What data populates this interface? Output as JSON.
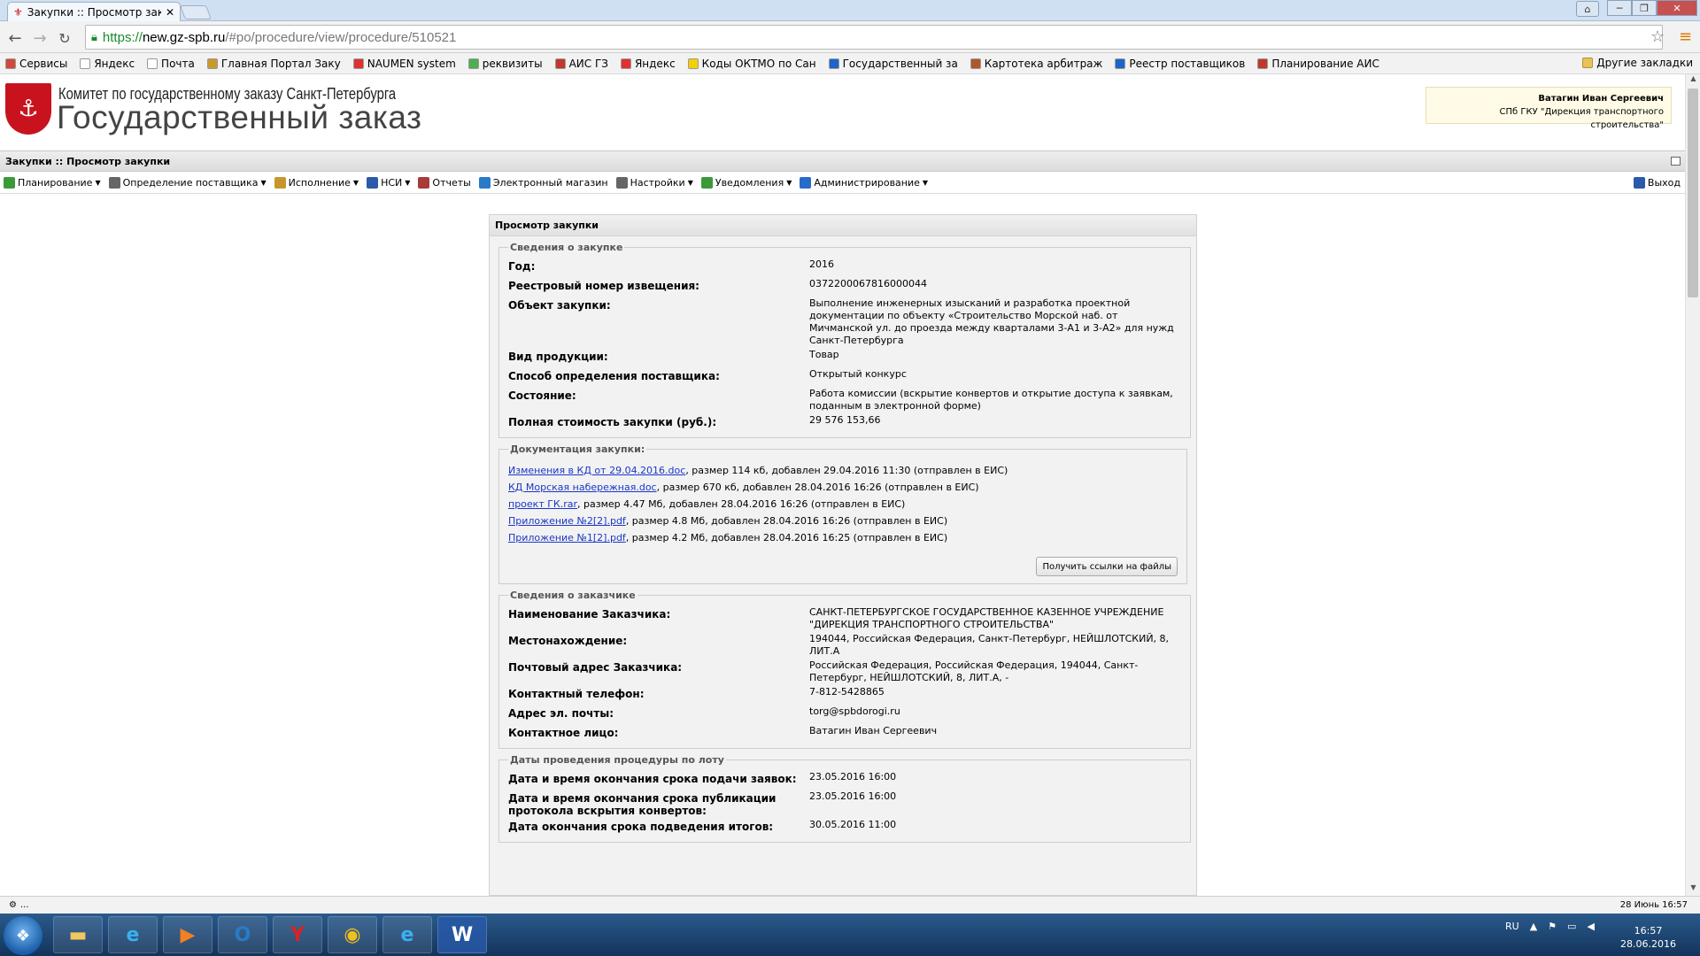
{
  "browser": {
    "tab_title": "Закупки :: Просмотр закупки",
    "url_scheme": "https://",
    "url_host": "new.gz-spb.ru",
    "url_path": "/#po/procedure/view/procedure/510521"
  },
  "bookmarks": [
    {
      "label": "Сервисы",
      "color": "#d04a3b"
    },
    {
      "label": "Яндекс",
      "color": "#ffffff"
    },
    {
      "label": "Почта",
      "color": "#ffffff"
    },
    {
      "label": "Главная Портал Заку",
      "color": "#c89a2a"
    },
    {
      "label": "NAUMEN system",
      "color": "#e03030"
    },
    {
      "label": "реквизиты",
      "color": "#4caf50"
    },
    {
      "label": "АИС ГЗ",
      "color": "#c0392b"
    },
    {
      "label": "Яндекс",
      "color": "#e03030"
    },
    {
      "label": "Коды ОКТМО по Сан",
      "color": "#f5d000"
    },
    {
      "label": "Государственный за",
      "color": "#1e64c8"
    },
    {
      "label": "Картотека арбитраж",
      "color": "#b0562a"
    },
    {
      "label": "Реестр поставщиков",
      "color": "#1e64c8"
    },
    {
      "label": "Планирование АИС",
      "color": "#c0392b"
    }
  ],
  "bookmarks_other": "Другие закладки",
  "header": {
    "org_name": "Комитет по государственному заказу Санкт-Петербурга",
    "site_title": "Государственный заказ",
    "user_name": "Ватагин Иван Сергеевич",
    "user_org": "СПб ГКУ \"Дирекция транспортного строительства\""
  },
  "panel_title": "Закупки :: Просмотр закупки",
  "menu": [
    {
      "label": "Планирование",
      "dropdown": true,
      "color": "#3a9a3a"
    },
    {
      "label": "Определение поставщика",
      "dropdown": true,
      "color": "#666666"
    },
    {
      "label": "Исполнение",
      "dropdown": true,
      "color": "#c8962a"
    },
    {
      "label": "НСИ",
      "dropdown": true,
      "color": "#2a5aa8"
    },
    {
      "label": "Отчеты",
      "dropdown": false,
      "color": "#a83a3a"
    },
    {
      "label": "Электронный магазин",
      "dropdown": false,
      "color": "#2a7ac8"
    },
    {
      "label": "Настройки",
      "dropdown": true,
      "color": "#666666"
    },
    {
      "label": "Уведомления",
      "dropdown": true,
      "color": "#3a9a3a"
    },
    {
      "label": "Администрирование",
      "dropdown": true,
      "color": "#2a6ac8"
    }
  ],
  "logout_label": "Выход",
  "view": {
    "title": "Просмотр закупки",
    "purchase_legend": "Сведения о закупке",
    "purchase": [
      {
        "label": "Год:",
        "value": "2016"
      },
      {
        "label": "Реестровый номер извещения:",
        "value": "0372200067816000044"
      },
      {
        "label": "Объект закупки:",
        "value": "Выполнение инженерных изысканий и разработка проектной документации по объекту «Строительство Морской наб. от Мичманской ул. до проезда между кварталами 3-А1 и 3-А2» для нужд Санкт-Петербурга"
      },
      {
        "label": "Вид продукции:",
        "value": "Товар"
      },
      {
        "label": "Способ определения поставщика:",
        "value": "Открытый конкурс"
      },
      {
        "label": "Состояние:",
        "value": "Работа комиссии (вскрытие конвертов и открытие доступа к заявкам, поданным в электронной форме)"
      },
      {
        "label": "Полная стоимость закупки (руб.):",
        "value": "29 576 153,66"
      }
    ],
    "docs_legend": "Документация закупки:",
    "docs": [
      {
        "name": "Изменения в КД   от 29.04.2016.doc",
        "info": ", размер 114 кб, добавлен 29.04.2016 11:30 (отправлен в ЕИС)"
      },
      {
        "name": "КД Морская набережная.doc",
        "info": ", размер 670 кб, добавлен 28.04.2016 16:26 (отправлен в ЕИС)"
      },
      {
        "name": "проект ГК.rar",
        "info": ", размер 4.47 Мб, добавлен 28.04.2016 16:26 (отправлен в ЕИС)"
      },
      {
        "name": "Приложение №2[2].pdf",
        "info": ", размер 4.8 Мб, добавлен 28.04.2016 16:26 (отправлен в ЕИС)"
      },
      {
        "name": "Приложение №1[2].pdf",
        "info": ", размер 4.2 Мб, добавлен 28.04.2016 16:25 (отправлен в ЕИС)"
      }
    ],
    "get_links_label": "Получить ссылки на файлы",
    "customer_legend": "Сведения о заказчике",
    "customer": [
      {
        "label": "Наименование Заказчика:",
        "value": "САНКТ-ПЕТЕРБУРГСКОЕ ГОСУДАРСТВЕННОЕ КАЗЕННОЕ УЧРЕЖДЕНИЕ \"ДИРЕКЦИЯ ТРАНСПОРТНОГО СТРОИТЕЛЬСТВА\""
      },
      {
        "label": "Местонахождение:",
        "value": "194044, Российская Федерация, Санкт-Петербург, НЕЙШЛОТСКИЙ, 8, ЛИТ.А"
      },
      {
        "label": "Почтовый адрес Заказчика:",
        "value": "Российская Федерация, Российская Федерация, 194044, Санкт-Петербург, НЕЙШЛОТСКИЙ, 8, ЛИТ.А, -"
      },
      {
        "label": "Контактный телефон:",
        "value": "7-812-5428865"
      },
      {
        "label": "Адрес эл. почты:",
        "value": "torg@spbdorogi.ru"
      },
      {
        "label": "Контактное лицо:",
        "value": "Ватагин Иван Сергеевич"
      }
    ],
    "dates_legend": "Даты проведения процедуры по лоту",
    "dates": [
      {
        "label": "Дата и время окончания срока подачи заявок:",
        "value": "23.05.2016 16:00"
      },
      {
        "label": "Дата и время окончания срока публикации протокола вскрытия конвертов:",
        "value": "23.05.2016 16:00"
      },
      {
        "label": "Дата окончания срока подведения итогов:",
        "value": "30.05.2016 11:00"
      }
    ]
  },
  "status": {
    "left": "...",
    "right": "28 Июнь 16:57"
  },
  "taskbar": {
    "lang": "RU",
    "time": "16:57",
    "date": "28.06.2016"
  }
}
